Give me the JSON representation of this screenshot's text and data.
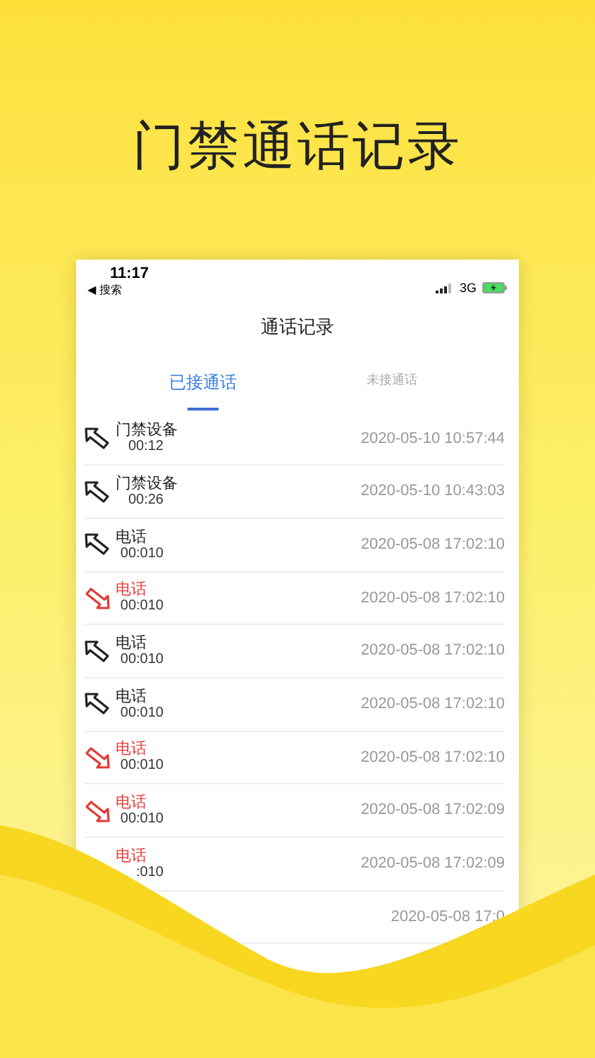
{
  "headline": "门禁通话记录",
  "status_bar": {
    "time": "11:17",
    "back": "◀ 搜索",
    "network": "3G"
  },
  "header": {
    "title": "通话记录"
  },
  "tabs": [
    {
      "label": "已接通话",
      "selected": true
    },
    {
      "label": "未接通话",
      "selected": false
    }
  ],
  "calls": [
    {
      "kind": "outgoing",
      "name": "门禁设备",
      "duration": "00:12",
      "time": "2020-05-10 10:57:44"
    },
    {
      "kind": "outgoing",
      "name": "门禁设备",
      "duration": "00:26",
      "time": "2020-05-10 10:43:03"
    },
    {
      "kind": "outgoing",
      "name": "电话",
      "duration": "00:010",
      "time": "2020-05-08 17:02:10"
    },
    {
      "kind": "missed",
      "name": "电话",
      "duration": "00:010",
      "time": "2020-05-08 17:02:10"
    },
    {
      "kind": "outgoing",
      "name": "电话",
      "duration": "00:010",
      "time": "2020-05-08 17:02:10"
    },
    {
      "kind": "outgoing",
      "name": "电话",
      "duration": "00:010",
      "time": "2020-05-08 17:02:10"
    },
    {
      "kind": "missed",
      "name": "电话",
      "duration": "00:010",
      "time": "2020-05-08 17:02:10"
    },
    {
      "kind": "missed",
      "name": "电话",
      "duration": "00:010",
      "time": "2020-05-08 17:02:09"
    },
    {
      "kind": "missed_covered",
      "name": "电话",
      "duration": ":010",
      "time": "2020-05-08 17:02:09"
    },
    {
      "kind": "hidden",
      "time": "2020-05-08 17:0"
    }
  ]
}
